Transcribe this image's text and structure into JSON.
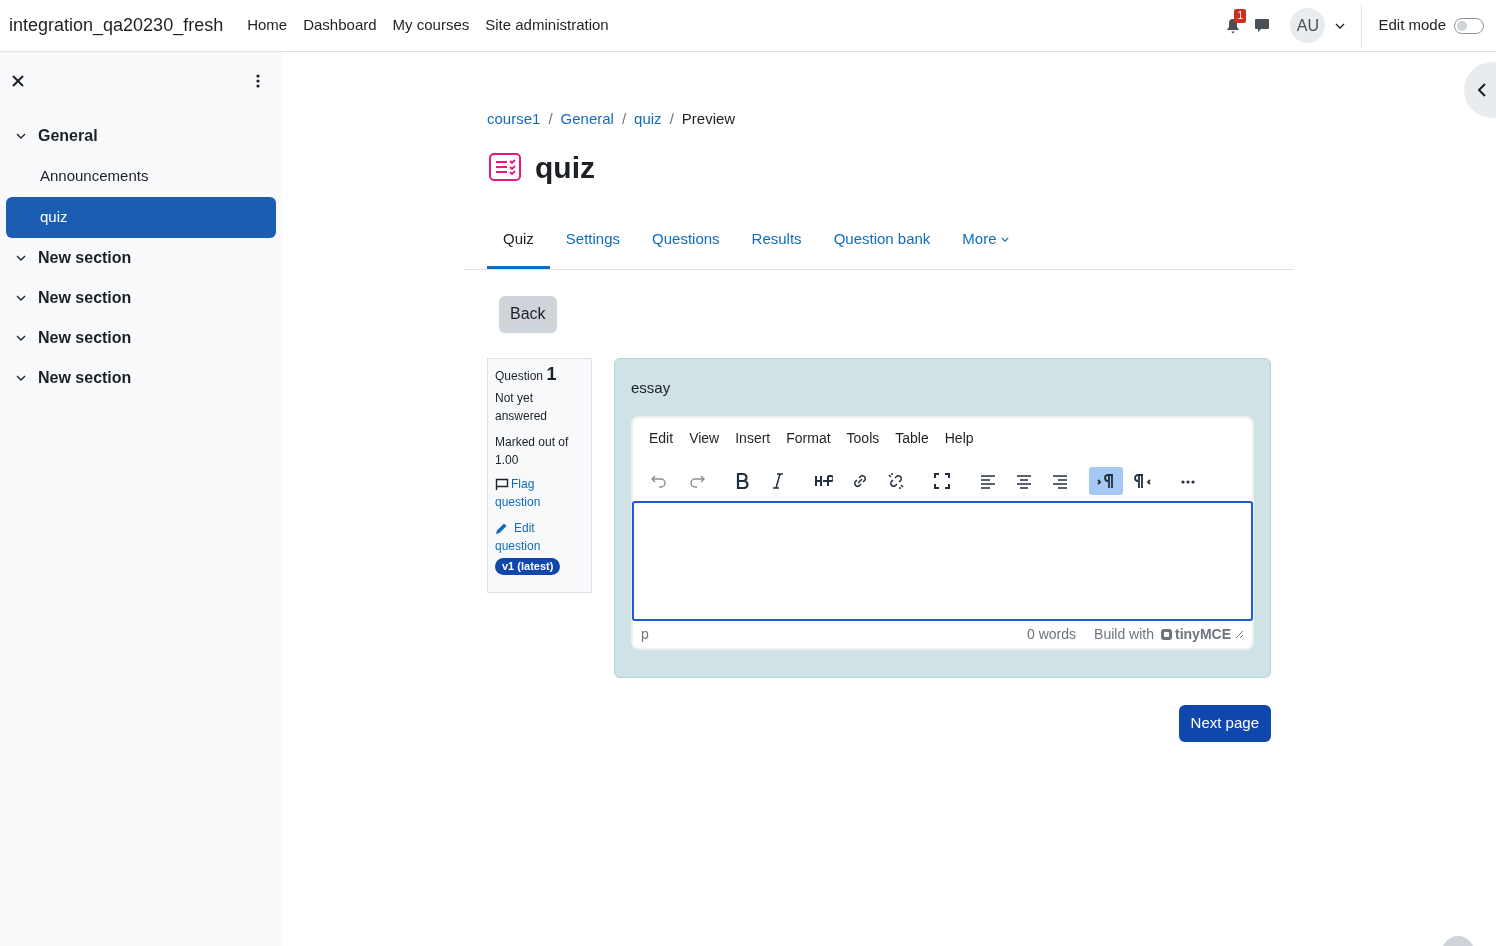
{
  "navbar": {
    "site_name": "integration_qa20230_fresh",
    "links": [
      "Home",
      "Dashboard",
      "My courses",
      "Site administration"
    ],
    "notification_count": "1",
    "user_initials": "AU",
    "edit_mode": {
      "label": "Edit mode",
      "on": false
    }
  },
  "sidebar": {
    "items": [
      {
        "label": "General",
        "kind": "section",
        "expanded": true,
        "selected": false
      },
      {
        "label": "Announcements",
        "kind": "activity",
        "selected": false
      },
      {
        "label": "quiz",
        "kind": "activity",
        "selected": true
      },
      {
        "label": "New section",
        "kind": "section",
        "expanded": true,
        "selected": false
      },
      {
        "label": "New section",
        "kind": "section",
        "expanded": true,
        "selected": false
      },
      {
        "label": "New section",
        "kind": "section",
        "expanded": true,
        "selected": false
      },
      {
        "label": "New section",
        "kind": "section",
        "expanded": true,
        "selected": false
      }
    ]
  },
  "breadcrumb": [
    "course1",
    "General",
    "quiz",
    "Preview"
  ],
  "breadcrumb_separator": "/",
  "page_title": "quiz",
  "tabs": [
    {
      "label": "Quiz",
      "selected": true
    },
    {
      "label": "Settings",
      "selected": false
    },
    {
      "label": "Questions",
      "selected": false
    },
    {
      "label": "Results",
      "selected": false
    },
    {
      "label": "Question bank",
      "selected": false
    },
    {
      "label": "More",
      "selected": false
    }
  ],
  "back_button": "Back",
  "question_info": {
    "title": "Question",
    "number": "1",
    "status": "Not yet answered",
    "marks": "Marked out of 1.00",
    "flag_link": "Flag question",
    "edit_link": "Edit question",
    "version_badge": "v1 (latest)"
  },
  "question": {
    "text": "essay",
    "editor": {
      "menu": [
        "Edit",
        "View",
        "Insert",
        "Format",
        "Tools",
        "Table",
        "Help"
      ],
      "toolbar": [
        {
          "kind": "undo",
          "disabled": true,
          "active": false
        },
        {
          "kind": "redo",
          "disabled": true,
          "active": false
        },
        {
          "kind": "bold",
          "disabled": false,
          "active": false
        },
        {
          "kind": "italic",
          "disabled": false,
          "active": false
        },
        {
          "kind": "h5p",
          "disabled": false,
          "active": false
        },
        {
          "kind": "link",
          "disabled": false,
          "active": false
        },
        {
          "kind": "unlink",
          "disabled": false,
          "active": false
        },
        {
          "kind": "fullscreen",
          "disabled": false,
          "active": false
        },
        {
          "kind": "align-left",
          "disabled": false,
          "active": false
        },
        {
          "kind": "align-center",
          "disabled": false,
          "active": false
        },
        {
          "kind": "align-right",
          "disabled": false,
          "active": false
        },
        {
          "kind": "ltr",
          "disabled": false,
          "active": true
        },
        {
          "kind": "rtl",
          "disabled": false,
          "active": false
        },
        {
          "kind": "more",
          "disabled": false,
          "active": false
        }
      ],
      "path": "p",
      "word_count": "0 words",
      "branding": "Build with",
      "brand": "tinyMCE"
    }
  },
  "next_button": "Next page"
}
